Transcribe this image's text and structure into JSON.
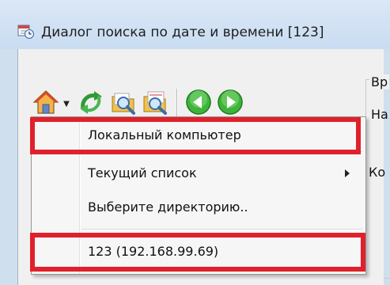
{
  "window": {
    "title": "Диалог поиска по дате и времени [123]"
  },
  "toolbar": {
    "buttons": [
      {
        "icon": "home-icon"
      },
      {
        "icon": "refresh-network-icon"
      },
      {
        "icon": "search-folder-icon"
      },
      {
        "icon": "search-folder-clock-icon"
      },
      {
        "icon": "back-arrow-icon"
      },
      {
        "icon": "forward-arrow-icon"
      }
    ]
  },
  "right_panel": {
    "group_label": "Вр",
    "line1": "На",
    "line2": "Ко"
  },
  "menu": {
    "items": [
      {
        "label": "Локальный компьютер",
        "submenu": false
      },
      {
        "label": "Текущий список",
        "submenu": true
      },
      {
        "label": "Выберите директорию..",
        "submenu": false
      },
      {
        "label": "123 (192.168.99.69)",
        "submenu": false
      }
    ]
  },
  "colors": {
    "highlight": "#e0202a",
    "green_arrow": "#2fae27"
  }
}
